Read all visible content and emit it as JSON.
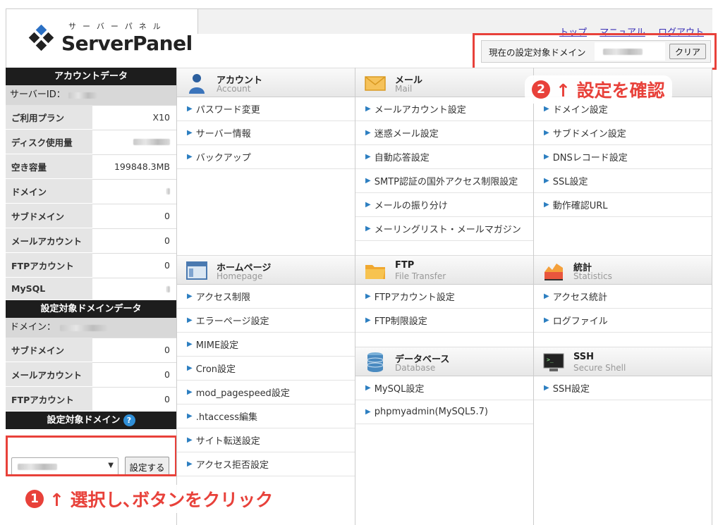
{
  "logo": {
    "kana": "サーバーパネル",
    "name": "ServerPanel"
  },
  "top_links": [
    "トップ",
    "マニュアル",
    "ログアウト"
  ],
  "current_domain": {
    "label": "現在の設定対象ドメイン",
    "clear": "クリア"
  },
  "callout2": {
    "num": "2",
    "text": "↑ 設定を確認"
  },
  "callout1": {
    "num": "1",
    "text": "↑ 選択し､ボタンをクリック"
  },
  "account_data": {
    "title": "アカウントデータ",
    "server_id_label": "サーバーID：",
    "rows": [
      {
        "k": "ご利用プラン",
        "v": "X10"
      },
      {
        "k": "ディスク使用量",
        "v": ""
      },
      {
        "k": "空き容量",
        "v": "199848.3MB"
      },
      {
        "k": "ドメイン",
        "v": ""
      },
      {
        "k": "サブドメイン",
        "v": "0"
      },
      {
        "k": "メールアカウント",
        "v": "0"
      },
      {
        "k": "FTPアカウント",
        "v": "0"
      },
      {
        "k": "MySQL",
        "v": ""
      }
    ]
  },
  "domain_data": {
    "title": "設定対象ドメインデータ",
    "domain_label": "ドメイン：",
    "rows": [
      {
        "k": "サブドメイン",
        "v": "0"
      },
      {
        "k": "メールアカウント",
        "v": "0"
      },
      {
        "k": "FTPアカウント",
        "v": "0"
      }
    ]
  },
  "domain_select": {
    "title": "設定対象ドメイン",
    "help": "?",
    "button": "設定する"
  },
  "sections": {
    "account": {
      "jp": "アカウント",
      "en": "Account",
      "items": [
        "パスワード変更",
        "サーバー情報",
        "バックアップ"
      ]
    },
    "mail": {
      "jp": "メール",
      "en": "Mail",
      "items": [
        "メールアカウント設定",
        "迷惑メール設定",
        "自動応答設定",
        "SMTP認証の国外アクセス制限設定",
        "メールの振り分け",
        "メーリングリスト・メールマガジン"
      ]
    },
    "domain": {
      "items": [
        "ドメイン設定",
        "サブドメイン設定",
        "DNSレコード設定",
        "SSL設定",
        "動作確認URL"
      ]
    },
    "homepage": {
      "jp": "ホームページ",
      "en": "Homepage",
      "items": [
        "アクセス制限",
        "エラーページ設定",
        "MIME設定",
        "Cron設定",
        "mod_pagespeed設定",
        ".htaccess編集",
        "サイト転送設定",
        "アクセス拒否設定"
      ]
    },
    "ftp": {
      "jp": "FTP",
      "en": "File Transfer",
      "items": [
        "FTPアカウント設定",
        "FTP制限設定"
      ]
    },
    "stats": {
      "jp": "統計",
      "en": "Statistics",
      "items": [
        "アクセス統計",
        "ログファイル"
      ]
    },
    "database": {
      "jp": "データベース",
      "en": "Database",
      "items": [
        "MySQL設定",
        "phpmyadmin(MySQL5.7)"
      ]
    },
    "ssh": {
      "jp": "SSH",
      "en": "Secure Shell",
      "items": [
        "SSH設定"
      ]
    }
  }
}
